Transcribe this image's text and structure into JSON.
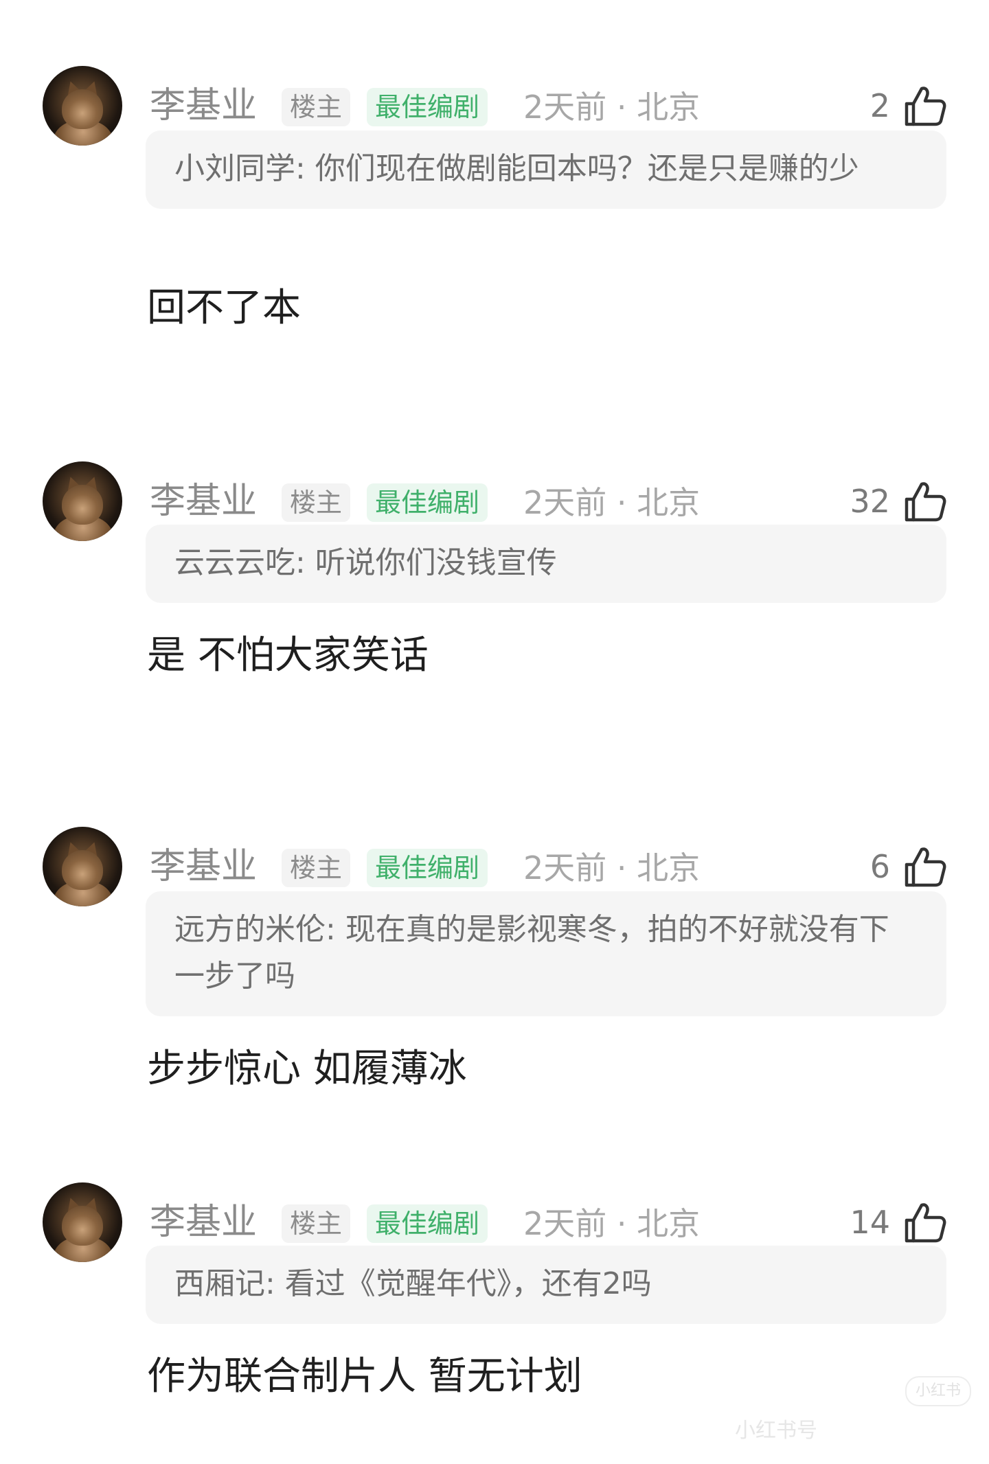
{
  "comments": [
    {
      "author": "李基业",
      "op_badge": "楼主",
      "best_badge": "最佳编剧",
      "meta": "2天前 · 北京",
      "likes": "2",
      "quoted": "小刘同学: 你们现在做剧能回本吗？还是只是赚的少",
      "reply": "回不了本"
    },
    {
      "author": "李基业",
      "op_badge": "楼主",
      "best_badge": "最佳编剧",
      "meta": "2天前 · 北京",
      "likes": "32",
      "quoted": "云云云吃: 听说你们没钱宣传",
      "reply": "是 不怕大家笑话"
    },
    {
      "author": "李基业",
      "op_badge": "楼主",
      "best_badge": "最佳编剧",
      "meta": "2天前 · 北京",
      "likes": "6",
      "quoted": "远方的米伦: 现在真的是影视寒冬，拍的不好就没有下一步了吗",
      "reply": "步步惊心 如履薄冰"
    },
    {
      "author": "李基业",
      "op_badge": "楼主",
      "best_badge": "最佳编剧",
      "meta": "2天前 · 北京",
      "likes": "14",
      "quoted": "西厢记: 看过《觉醒年代》，还有2吗",
      "reply": "作为联合制片人 暂无计划"
    }
  ],
  "watermark": {
    "logo": "小红书",
    "text": "小红书号"
  },
  "icons": {
    "like": "thumbs-up-icon",
    "avatar": "cat-avatar"
  },
  "colors": {
    "best_badge_text": "#3fb06a",
    "best_badge_bg": "#eaf7ef",
    "quote_bg": "#f5f5f5"
  }
}
